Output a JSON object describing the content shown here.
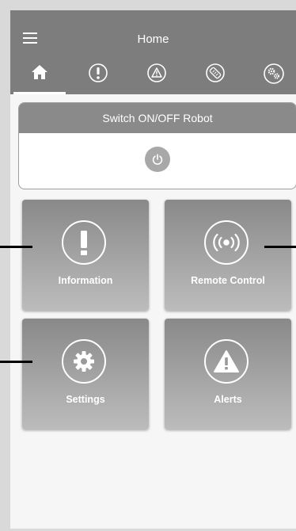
{
  "header": {
    "title": "Home"
  },
  "tabs": [
    {
      "name": "home",
      "icon": "home-icon",
      "active": true
    },
    {
      "name": "information",
      "icon": "exclamation-circle-icon",
      "active": false
    },
    {
      "name": "alerts",
      "icon": "warning-triangle-icon",
      "active": false
    },
    {
      "name": "remote-control",
      "icon": "remote-icon",
      "active": false
    },
    {
      "name": "settings",
      "icon": "gears-icon",
      "active": false
    }
  ],
  "switch_card": {
    "title": "Switch ON/OFF Robot",
    "power_icon": "power-icon"
  },
  "tiles": [
    {
      "label": "Information",
      "icon": "exclamation-icon"
    },
    {
      "label": "Remote Control",
      "icon": "broadcast-icon"
    },
    {
      "label": "Settings",
      "icon": "gear-icon"
    },
    {
      "label": "Alerts",
      "icon": "warning-triangle-icon"
    }
  ],
  "colors": {
    "header_bg": "#7d7d7d",
    "tile_gradient_top": "#898989",
    "tile_gradient_bottom": "#bcbcbc",
    "page_bg": "#f6f6f6"
  }
}
